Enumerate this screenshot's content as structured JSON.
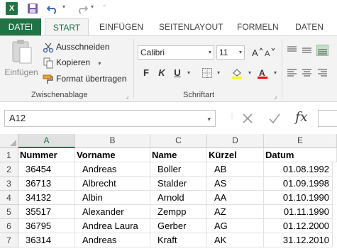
{
  "quick_access": {
    "app_icon_letter": "X",
    "icons": [
      "excel-logo-icon",
      "save-icon",
      "undo-icon",
      "redo-icon",
      "customize-icon"
    ],
    "undo_dropdown": "▾",
    "redo_dropdown": "▾",
    "customize": "⁼"
  },
  "tabs": [
    {
      "label": "DATEI"
    },
    {
      "label": "START"
    },
    {
      "label": "EINFÜGEN"
    },
    {
      "label": "SEITENLAYOUT"
    },
    {
      "label": "FORMELN"
    },
    {
      "label": "DATEN"
    }
  ],
  "ribbon": {
    "clipboard": {
      "paste_label": "Einfügen",
      "cut_label": "Ausschneiden",
      "copy_label": "Kopieren",
      "copy_dropdown": "▾",
      "format_painter_label": "Format übertragen",
      "group_label": "Zwischenablage"
    },
    "font": {
      "font_name": "Calibri",
      "font_size": "11",
      "bold": "F",
      "italic": "K",
      "underline": "U",
      "group_label": "Schriftart"
    },
    "colors": {
      "excel_green": "#217346",
      "fill_highlight": "#ffff00",
      "font_color": "#ff0000"
    }
  },
  "formula_bar": {
    "name_box": "A12",
    "fx_label": "fx",
    "formula_value": ""
  },
  "sheet": {
    "columns": [
      "A",
      "B",
      "C",
      "D",
      "E"
    ],
    "rows": [
      "1",
      "2",
      "3",
      "4",
      "5",
      "6",
      "7"
    ],
    "header": [
      "Nummer",
      "Vorname",
      "Name",
      "Kürzel",
      "Datum"
    ],
    "data": [
      [
        "36454",
        "Andreas",
        "Boller",
        "AB",
        "01.08.1992"
      ],
      [
        "36713",
        "Albrecht",
        "Stalder",
        "AS",
        "01.09.1998"
      ],
      [
        "34132",
        "Albin",
        "Arnold",
        "AA",
        "01.10.1990"
      ],
      [
        "35517",
        "Alexander",
        "Zempp",
        "AZ",
        "01.11.1990"
      ],
      [
        "36795",
        "Andrea Laura",
        "Gerber",
        "AG",
        "01.12.2000"
      ],
      [
        "36314",
        "Andreas",
        "Kraft",
        "AK",
        "31.12.2010"
      ]
    ]
  }
}
